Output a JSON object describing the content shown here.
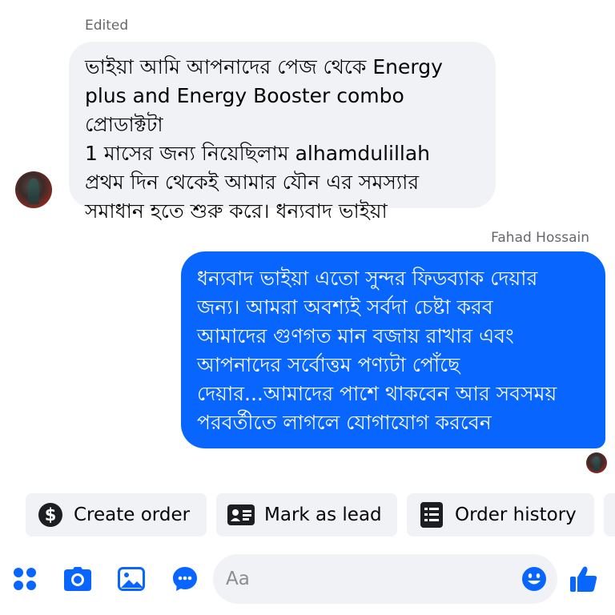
{
  "thread": {
    "edited_label": "Edited",
    "sender_name": "Fahad Hossain"
  },
  "messages": [
    {
      "direction": "incoming",
      "text": "ভাইয়া আমি আপনাদের পেজ থেকে Energy\nplus and Energy Booster combo প্রোডাক্টটা\n1 মাসের জন্য নিয়েছিলাম alhamdulillah\nপ্রথম দিন থেকেই আমার যৌন এর সমস্যার\nসমাধান হতে শুরু করে। ধন্যবাদ ভাইয়া"
    },
    {
      "direction": "outgoing",
      "text": "ধন্যবাদ ভাইয়া এতো সুন্দর ফিডব্যাক দেয়ার\nজন্য। আমরা অবশ্যই সর্বদা চেষ্টা করব\nআমাদের গুণগত মান বজায় রাখার এবং\nআপনাদের সর্বোত্তম পণ্যটা পোঁছে\nদেয়ার...আমাদের পাশে থাকবেন আর সবসময়\nপরবর্তীতে লাগলে যোগাযোগ করবেন"
    }
  ],
  "quick_actions": [
    {
      "label": "Create order",
      "icon": "dollar-icon"
    },
    {
      "label": "Mark as lead",
      "icon": "contact-card-icon"
    },
    {
      "label": "Order history",
      "icon": "receipt-list-icon"
    }
  ],
  "composer": {
    "placeholder": "Aa",
    "tools": [
      "apps-icon",
      "camera-icon",
      "gallery-icon",
      "chat-bubble-icon"
    ],
    "emoji_icon": "smiley-icon",
    "send_icon": "thumbs-up-icon"
  },
  "colors": {
    "accent": "#0866ff",
    "incoming_bubble": "#f0f2f5",
    "meta_text": "#65676b"
  }
}
